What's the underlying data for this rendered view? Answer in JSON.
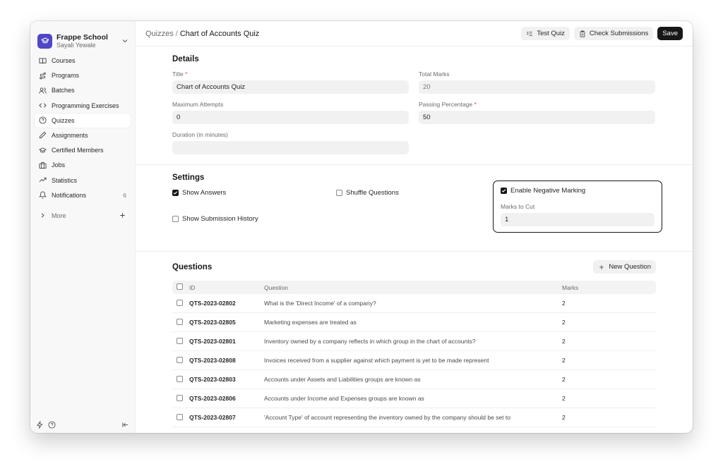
{
  "sidebar": {
    "org_name": "Frappe School",
    "user_name": "Sayali Yewale",
    "items": [
      {
        "label": "Courses",
        "icon": "book-icon"
      },
      {
        "label": "Programs",
        "icon": "route-icon"
      },
      {
        "label": "Batches",
        "icon": "users-icon"
      },
      {
        "label": "Programming Exercises",
        "icon": "code-icon"
      },
      {
        "label": "Quizzes",
        "icon": "help-circle-icon",
        "active": true
      },
      {
        "label": "Assignments",
        "icon": "pencil-icon"
      },
      {
        "label": "Certified Members",
        "icon": "graduation-cap-icon"
      },
      {
        "label": "Jobs",
        "icon": "briefcase-icon"
      },
      {
        "label": "Statistics",
        "icon": "trending-up-icon"
      },
      {
        "label": "Notifications",
        "icon": "bell-icon",
        "count": "6"
      }
    ],
    "more_label": "More"
  },
  "header": {
    "crumb_root": "Quizzes",
    "crumb_sep": "/",
    "crumb_current": "Chart of Accounts Quiz",
    "test_quiz": "Test Quiz",
    "check_submissions": "Check Submissions",
    "save": "Save"
  },
  "details": {
    "title": "Details",
    "title_label": "Title",
    "title_value": "Chart of Accounts Quiz",
    "total_marks_label": "Total Marks",
    "total_marks_value": "20",
    "max_attempts_label": "Maximum Attempts",
    "max_attempts_value": "0",
    "passing_label": "Passing Percentage",
    "passing_value": "50",
    "duration_label": "Duration (in minutes)",
    "duration_value": ""
  },
  "settings": {
    "title": "Settings",
    "show_answers": {
      "label": "Show Answers",
      "checked": true
    },
    "shuffle_questions": {
      "label": "Shuffle Questions",
      "checked": false
    },
    "enable_negative": {
      "label": "Enable Negative Marking",
      "checked": true
    },
    "show_history": {
      "label": "Show Submission History",
      "checked": false
    },
    "marks_to_cut_label": "Marks to Cut",
    "marks_to_cut_value": "1"
  },
  "questions": {
    "title": "Questions",
    "new_question": "New Question",
    "columns": {
      "id": "ID",
      "question": "Question",
      "marks": "Marks"
    },
    "rows": [
      {
        "id": "QTS-2023-02802",
        "question": "What is the 'Direct Income' of a company?",
        "marks": "2"
      },
      {
        "id": "QTS-2023-02805",
        "question": "Marketing expenses are treated as",
        "marks": "2"
      },
      {
        "id": "QTS-2023-02801",
        "question": "Inventory owned by a company reflects in which group in the chart of accounts?",
        "marks": "2"
      },
      {
        "id": "QTS-2023-02808",
        "question": "Invoices received from a supplier against which payment is yet to be made represent",
        "marks": "2"
      },
      {
        "id": "QTS-2023-02803",
        "question": "Accounts under Assets and Liabilities groups are known as",
        "marks": "2"
      },
      {
        "id": "QTS-2023-02806",
        "question": "Accounts under Income and Expenses groups are known as",
        "marks": "2"
      },
      {
        "id": "QTS-2023-02807",
        "question": "'Account Type' of account representing the inventory owned by the company should be set to",
        "marks": "2"
      }
    ]
  },
  "colors": {
    "accent": "#4f46c8",
    "dark": "#171717",
    "required": "#e5484d"
  }
}
